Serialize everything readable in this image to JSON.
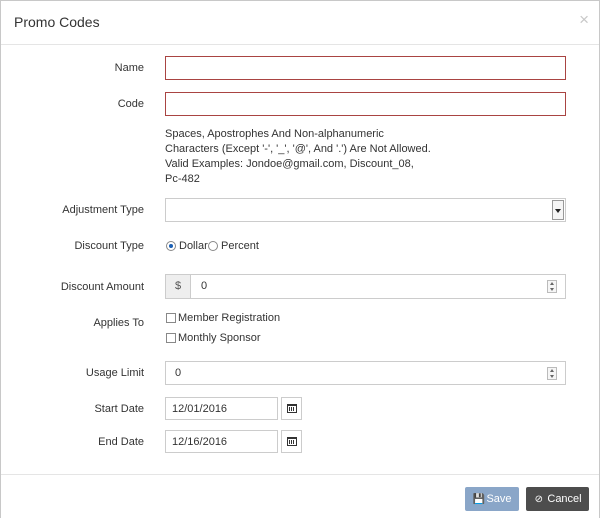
{
  "modal": {
    "title": "Promo Codes",
    "close": "×"
  },
  "form": {
    "name": {
      "label": "Name",
      "value": ""
    },
    "code": {
      "label": "Code",
      "value": ""
    },
    "code_help": [
      "Spaces, Apostrophes And Non-alphanumeric",
      "Characters (Except '-', '_', '@', And '.') Are Not Allowed.",
      "Valid Examples: Jondoe@gmail.com, Discount_08,",
      "Pc-482"
    ],
    "adjustment_type": {
      "label": "Adjustment Type",
      "value": ""
    },
    "discount_type": {
      "label": "Discount Type",
      "options": [
        "Dollar",
        "Percent"
      ],
      "selected": "Dollar"
    },
    "discount_amount": {
      "label": "Discount Amount",
      "prefix": "$",
      "value": "0"
    },
    "applies_to": {
      "label": "Applies To",
      "options": [
        "Member Registration",
        "Monthly Sponsor"
      ]
    },
    "usage_limit": {
      "label": "Usage Limit",
      "value": "0"
    },
    "start_date": {
      "label": "Start Date",
      "value": "12/01/2016"
    },
    "end_date": {
      "label": "End Date",
      "value": "12/16/2016"
    }
  },
  "footer": {
    "save_label": "Save",
    "cancel_label": "Cancel"
  },
  "icons": {
    "save": "floppy-disk-icon",
    "cancel": "ban-icon",
    "calendar": "calendar-icon"
  },
  "colors": {
    "save_button": "#8aa6c8",
    "cancel_button": "#4d4d4d",
    "error_border": "#a94442"
  }
}
